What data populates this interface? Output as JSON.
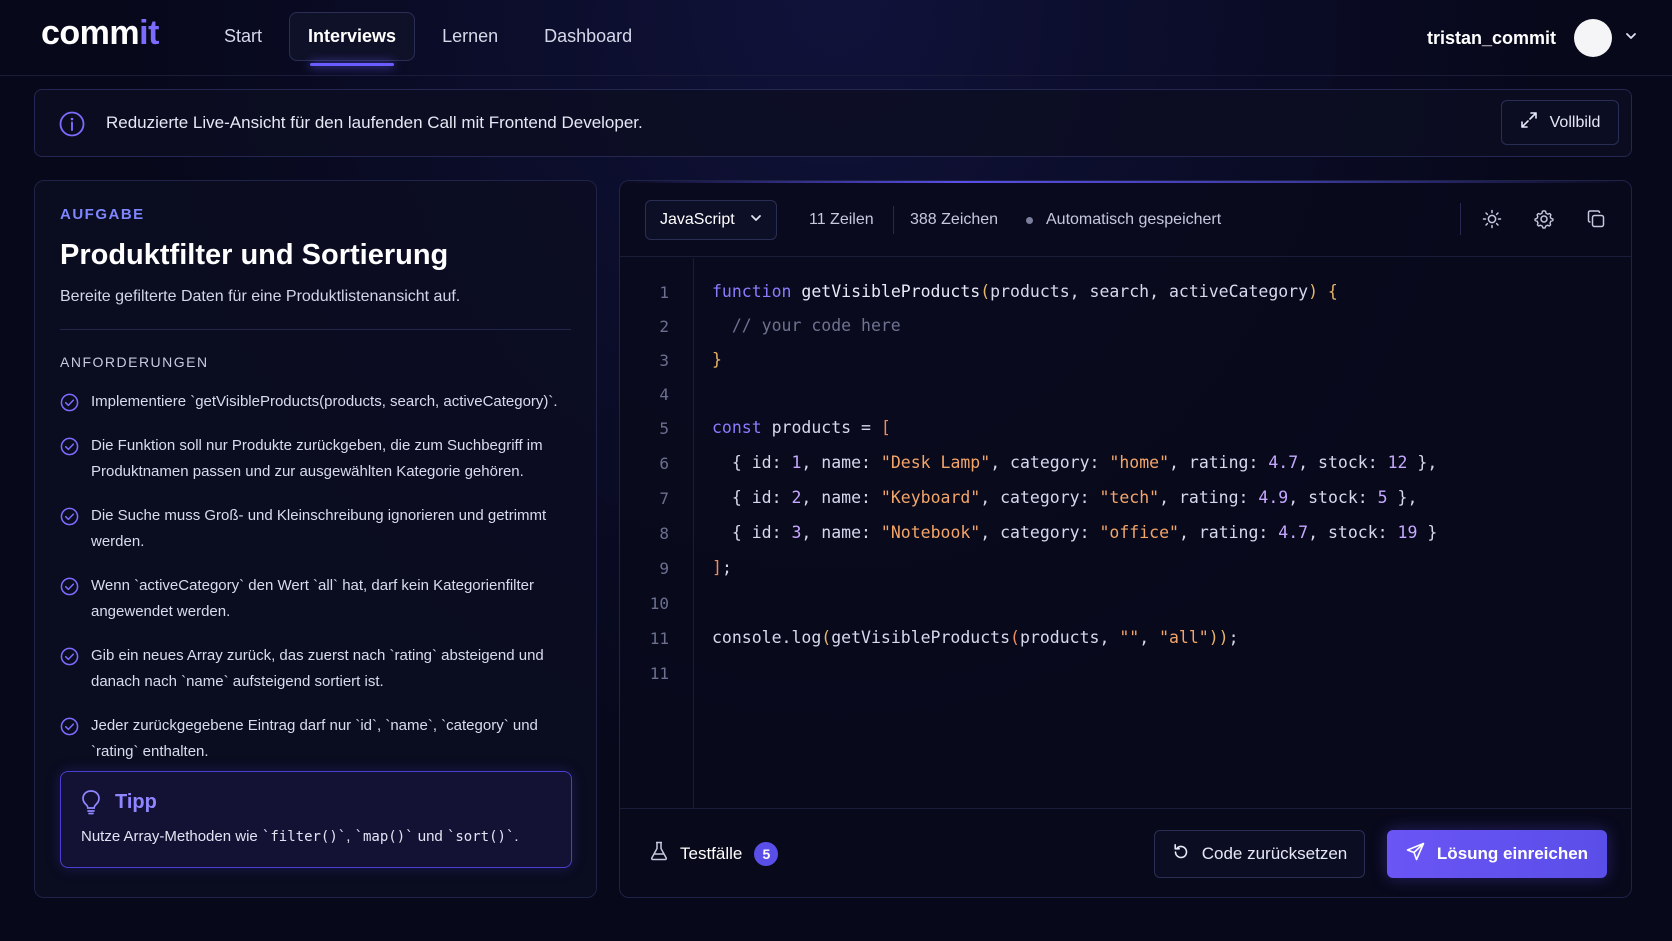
{
  "app": {
    "logo_main": "comm",
    "logo_accent": "it"
  },
  "nav": {
    "items": [
      {
        "label": "Start",
        "active": false
      },
      {
        "label": "Interviews",
        "active": true
      },
      {
        "label": "Lernen",
        "active": false
      },
      {
        "label": "Dashboard",
        "active": false
      }
    ]
  },
  "user": {
    "name": "tristan_commit"
  },
  "banner": {
    "text": "Reduzierte Live-Ansicht für den laufenden Call mit Frontend Developer.",
    "fullscreen_label": "Vollbild"
  },
  "task": {
    "kicker": "AUFGABE",
    "title": "Produktfilter und Sortierung",
    "subtitle": "Bereite gefilterte Daten für eine Produktlistenansicht auf.",
    "requirements_heading": "ANFORDERUNGEN",
    "requirements": [
      "Implementiere `getVisibleProducts(products, search, activeCategory)`.",
      "Die Funktion soll nur Produkte zurückgeben, die zum Suchbegriff im Produktnamen passen und zur ausgewählten Kategorie gehören.",
      "Die Suche muss Groß- und Kleinschreibung ignorieren und getrimmt werden.",
      "Wenn `activeCategory` den Wert `all` hat, darf kein Kategorienfilter angewendet werden.",
      "Gib ein neues Array zurück, das zuerst nach `rating` absteigend und danach nach `name` aufsteigend sortiert ist.",
      "Jeder zurückgegebene Eintrag darf nur `id`, `name`, `category` und `rating` enthalten."
    ],
    "tip_title": "Tipp",
    "tip_prefix": "Nutze Array-Methoden wie ",
    "tip_code1": "`filter()`",
    "tip_code2": "`map()`",
    "tip_and": " und ",
    "tip_code3": "`sort()`",
    "tip_suffix": "."
  },
  "editor": {
    "language": "JavaScript",
    "lines_stat": "11 Zeilen",
    "chars_stat": "388 Zeichen",
    "save_status": "Automatisch gespeichert",
    "line_numbers": [
      "1",
      "2",
      "3",
      "4",
      "5",
      "6",
      "7",
      "8",
      "9",
      "10",
      "11",
      "11"
    ],
    "code": {
      "l1_kw": "function",
      "l1_fn": " getVisibleProducts",
      "l1_open": "(",
      "l1_params": "products, search, activeCategory",
      "l1_close": ")",
      "l1_brace": " {",
      "l2": "  // your code here",
      "l3": "}",
      "l5_kw": "const",
      "l5_rest": " products = ",
      "l5_br": "[",
      "p1_id": "1",
      "p1_name": "\"Desk Lamp\"",
      "p1_cat": "\"home\"",
      "p1_rating": "4.7",
      "p1_stock": "12",
      "p2_id": "2",
      "p2_name": "\"Keyboard\"",
      "p2_cat": "\"tech\"",
      "p2_rating": "4.9",
      "p2_stock": "5",
      "p3_id": "3",
      "p3_name": "\"Notebook\"",
      "p3_cat": "\"office\"",
      "p3_rating": "4.7",
      "p3_stock": "19",
      "l9_br": "]",
      "l9_semi": ";",
      "l11_a": "console.log",
      "l11_o1": "(",
      "l11_b": "getVisibleProducts",
      "l11_o2": "(",
      "l11_c": "products, ",
      "l11_s1": "\"\"",
      "l11_comma": ", ",
      "l11_s2": "\"all\"",
      "l11_close": "))",
      "l11_semi": ";"
    }
  },
  "footer": {
    "tests_label": "Testfälle",
    "tests_count": "5",
    "reset_label": "Code zurücksetzen",
    "submit_label": "Lösung einreichen"
  }
}
